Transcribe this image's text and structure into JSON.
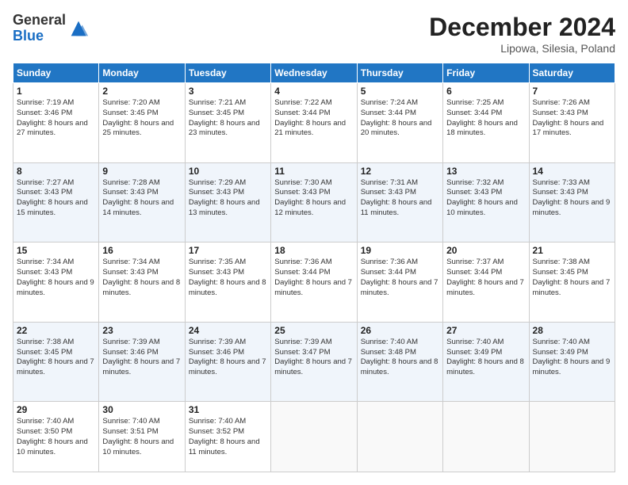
{
  "header": {
    "logo_line1": "General",
    "logo_line2": "Blue",
    "month": "December 2024",
    "location": "Lipowa, Silesia, Poland"
  },
  "weekdays": [
    "Sunday",
    "Monday",
    "Tuesday",
    "Wednesday",
    "Thursday",
    "Friday",
    "Saturday"
  ],
  "weeks": [
    [
      {
        "day": "1",
        "sunrise": "7:19 AM",
        "sunset": "3:46 PM",
        "daylight": "8 hours and 27 minutes."
      },
      {
        "day": "2",
        "sunrise": "7:20 AM",
        "sunset": "3:45 PM",
        "daylight": "8 hours and 25 minutes."
      },
      {
        "day": "3",
        "sunrise": "7:21 AM",
        "sunset": "3:45 PM",
        "daylight": "8 hours and 23 minutes."
      },
      {
        "day": "4",
        "sunrise": "7:22 AM",
        "sunset": "3:44 PM",
        "daylight": "8 hours and 21 minutes."
      },
      {
        "day": "5",
        "sunrise": "7:24 AM",
        "sunset": "3:44 PM",
        "daylight": "8 hours and 20 minutes."
      },
      {
        "day": "6",
        "sunrise": "7:25 AM",
        "sunset": "3:44 PM",
        "daylight": "8 hours and 18 minutes."
      },
      {
        "day": "7",
        "sunrise": "7:26 AM",
        "sunset": "3:43 PM",
        "daylight": "8 hours and 17 minutes."
      }
    ],
    [
      {
        "day": "8",
        "sunrise": "7:27 AM",
        "sunset": "3:43 PM",
        "daylight": "8 hours and 15 minutes."
      },
      {
        "day": "9",
        "sunrise": "7:28 AM",
        "sunset": "3:43 PM",
        "daylight": "8 hours and 14 minutes."
      },
      {
        "day": "10",
        "sunrise": "7:29 AM",
        "sunset": "3:43 PM",
        "daylight": "8 hours and 13 minutes."
      },
      {
        "day": "11",
        "sunrise": "7:30 AM",
        "sunset": "3:43 PM",
        "daylight": "8 hours and 12 minutes."
      },
      {
        "day": "12",
        "sunrise": "7:31 AM",
        "sunset": "3:43 PM",
        "daylight": "8 hours and 11 minutes."
      },
      {
        "day": "13",
        "sunrise": "7:32 AM",
        "sunset": "3:43 PM",
        "daylight": "8 hours and 10 minutes."
      },
      {
        "day": "14",
        "sunrise": "7:33 AM",
        "sunset": "3:43 PM",
        "daylight": "8 hours and 9 minutes."
      }
    ],
    [
      {
        "day": "15",
        "sunrise": "7:34 AM",
        "sunset": "3:43 PM",
        "daylight": "8 hours and 9 minutes."
      },
      {
        "day": "16",
        "sunrise": "7:34 AM",
        "sunset": "3:43 PM",
        "daylight": "8 hours and 8 minutes."
      },
      {
        "day": "17",
        "sunrise": "7:35 AM",
        "sunset": "3:43 PM",
        "daylight": "8 hours and 8 minutes."
      },
      {
        "day": "18",
        "sunrise": "7:36 AM",
        "sunset": "3:44 PM",
        "daylight": "8 hours and 7 minutes."
      },
      {
        "day": "19",
        "sunrise": "7:36 AM",
        "sunset": "3:44 PM",
        "daylight": "8 hours and 7 minutes."
      },
      {
        "day": "20",
        "sunrise": "7:37 AM",
        "sunset": "3:44 PM",
        "daylight": "8 hours and 7 minutes."
      },
      {
        "day": "21",
        "sunrise": "7:38 AM",
        "sunset": "3:45 PM",
        "daylight": "8 hours and 7 minutes."
      }
    ],
    [
      {
        "day": "22",
        "sunrise": "7:38 AM",
        "sunset": "3:45 PM",
        "daylight": "8 hours and 7 minutes."
      },
      {
        "day": "23",
        "sunrise": "7:39 AM",
        "sunset": "3:46 PM",
        "daylight": "8 hours and 7 minutes."
      },
      {
        "day": "24",
        "sunrise": "7:39 AM",
        "sunset": "3:46 PM",
        "daylight": "8 hours and 7 minutes."
      },
      {
        "day": "25",
        "sunrise": "7:39 AM",
        "sunset": "3:47 PM",
        "daylight": "8 hours and 7 minutes."
      },
      {
        "day": "26",
        "sunrise": "7:40 AM",
        "sunset": "3:48 PM",
        "daylight": "8 hours and 8 minutes."
      },
      {
        "day": "27",
        "sunrise": "7:40 AM",
        "sunset": "3:49 PM",
        "daylight": "8 hours and 8 minutes."
      },
      {
        "day": "28",
        "sunrise": "7:40 AM",
        "sunset": "3:49 PM",
        "daylight": "8 hours and 9 minutes."
      }
    ],
    [
      {
        "day": "29",
        "sunrise": "7:40 AM",
        "sunset": "3:50 PM",
        "daylight": "8 hours and 10 minutes."
      },
      {
        "day": "30",
        "sunrise": "7:40 AM",
        "sunset": "3:51 PM",
        "daylight": "8 hours and 10 minutes."
      },
      {
        "day": "31",
        "sunrise": "7:40 AM",
        "sunset": "3:52 PM",
        "daylight": "8 hours and 11 minutes."
      },
      null,
      null,
      null,
      null
    ]
  ]
}
